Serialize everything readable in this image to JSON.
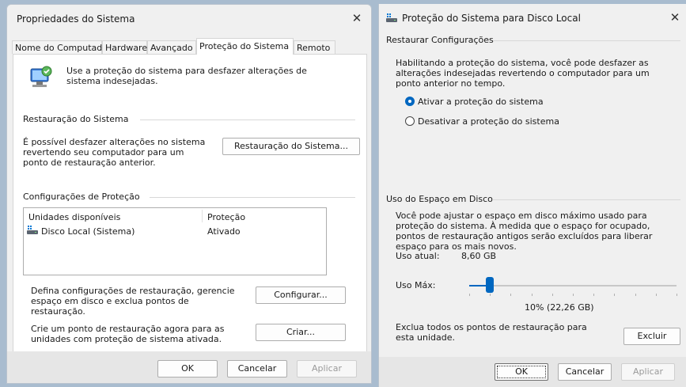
{
  "left_window": {
    "title": "Propriedades do Sistema",
    "tabs": [
      "Nome do Computador",
      "Hardware",
      "Avançado",
      "Proteção do Sistema",
      "Remoto"
    ],
    "active_tab": "Proteção do Sistema",
    "intro": "Use a proteção do sistema para desfazer alterações de sistema indesejadas.",
    "restore_group": "Restauração do Sistema",
    "restore_text": "É possível desfazer alterações no sistema revertendo seu computador para um ponto de restauração anterior.",
    "restore_button": "Restauração do Sistema...",
    "protection_group": "Configurações de Proteção",
    "list_headers": [
      "Unidades disponíveis",
      "Proteção"
    ],
    "list_rows": [
      {
        "drive": "Disco Local (Sistema)",
        "protection": "Ativado"
      }
    ],
    "configure_text": "Defina configurações de restauração, gerencie espaço em disco e exclua pontos de restauração.",
    "configure_button": "Configurar...",
    "create_text": "Crie um ponto de restauração agora para as unidades com proteção de sistema ativada.",
    "create_button": "Criar...",
    "ok": "OK",
    "cancel": "Cancelar",
    "apply": "Aplicar"
  },
  "right_window": {
    "title": "Proteção do Sistema para Disco Local",
    "restore_group": "Restaurar Configurações",
    "restore_text": "Habilitando a proteção do sistema, você pode desfazer as alterações indesejadas revertendo o computador para um ponto anterior no tempo.",
    "radio_on": "Ativar a proteção do sistema",
    "radio_off": "Desativar a proteção do sistema",
    "disk_group": "Uso do Espaço em Disco",
    "disk_text": "Você pode ajustar o espaço em disco máximo usado para proteção do sistema. À medida que o espaço for ocupado, pontos de restauração antigos serão excluídos para liberar espaço para os mais novos.",
    "current_label": "Uso atual:",
    "current_value": "8,60 GB",
    "max_label": "Uso Máx:",
    "max_value_text": "10% (22,26 GB)",
    "max_percent": 10,
    "delete_text": "Exclua todos os pontos de restauração para esta unidade.",
    "delete_button": "Excluir",
    "ok": "OK",
    "cancel": "Cancelar",
    "apply": "Aplicar"
  },
  "colors": {
    "accent": "#0067c0",
    "desktop": "#a9bccf"
  }
}
